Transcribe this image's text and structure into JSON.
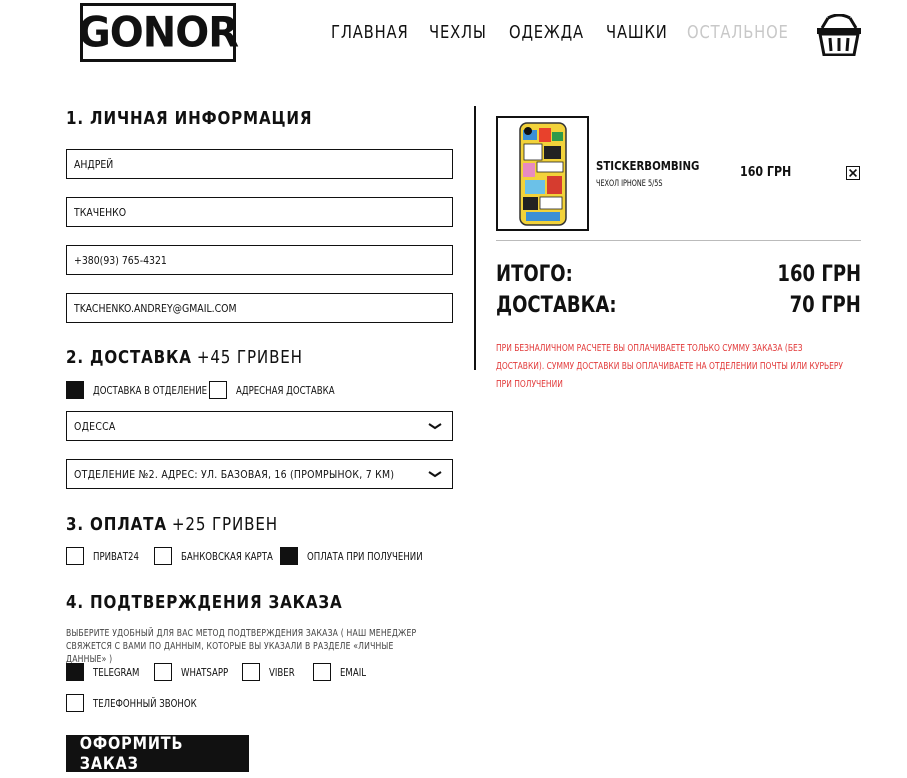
{
  "header": {
    "logo_text": "GONOR",
    "nav": [
      "ГЛАВНАЯ",
      "ЧЕХЛЫ",
      "ОДЕЖДА",
      "ЧАШКИ",
      "ОСТАЛЬНОЕ"
    ],
    "cart_icon": "basket-icon"
  },
  "personal": {
    "title": "1. ЛИЧНАЯ ИНФОРМАЦИЯ",
    "first_name": "АНДРЕЙ",
    "last_name": "ТКАЧЕНКО",
    "phone": "+380(93) 765-4321",
    "email": "TKACHENKO.ANDREY@GMAIL.COM"
  },
  "delivery": {
    "title": "2. ДОСТАВКА",
    "extra": "+45 ГРИВЕН",
    "options": [
      {
        "label": "ДОСТАВКА В ОТДЕЛЕНИЕ",
        "checked": true
      },
      {
        "label": "АДРЕСНАЯ ДОСТАВКА",
        "checked": false
      }
    ],
    "city": "ОДЕССА",
    "branch": "ОТДЕЛЕНИЕ №2. АДРЕС: УЛ. БАЗОВАЯ, 16 (ПРОМРЫНОК, 7 КМ)"
  },
  "payment": {
    "title": "3. ОПЛАТА",
    "extra": "+25 ГРИВЕН",
    "options": [
      {
        "label": "ПРИВАТ24",
        "checked": false
      },
      {
        "label": "БАНКОВСКАЯ КАРТА",
        "checked": false
      },
      {
        "label": "ОПЛАТА ПРИ ПОЛУЧЕНИИ",
        "checked": true
      }
    ]
  },
  "confirm": {
    "title": "4. ПОДТВЕРЖДЕНИЯ ЗАКАЗА",
    "hint": "ВЫБЕРИТЕ УДОБНЫЙ ДЛЯ ВАС МЕТОД ПОДТВЕРЖДЕНИЯ ЗАКАЗА ( НАШ МЕНЕДЖЕР СВЯЖЕТСЯ С ВАМИ ПО ДАННЫМ, КОТОРЫЕ ВЫ УКАЗАЛИ В РАЗДЕЛЕ «ЛИЧНЫЕ ДАННЫЕ» )",
    "options": [
      {
        "label": "TELEGRAM",
        "checked": true
      },
      {
        "label": "WHATSAPP",
        "checked": false
      },
      {
        "label": "VIBER",
        "checked": false
      },
      {
        "label": "EMAIL",
        "checked": false
      },
      {
        "label": "ТЕЛЕФОННЫЙ ЗВОНОК",
        "checked": false
      }
    ]
  },
  "submit_label": "ОФОРМИТЬ ЗАКАЗ",
  "cart": {
    "item_name": "STICKERBOMBING",
    "item_sub": "ЧЕХОЛ IPHONE 5/5S",
    "item_price": "160 ГРН",
    "total_label": "ИТОГО:",
    "total_value": "160 ГРН",
    "delivery_label": "ДОСТАВКА:",
    "delivery_value": "70 ГРН",
    "note": "ПРИ БЕЗНАЛИЧНОМ РАСЧЁТЕ ВЫ ОПЛАЧИВАЕТЕ ТОЛЬКО СУММУ ЗАКАЗА (БЕЗ ДОСТАВКИ). СУММУ ДОСТАВКИ ВЫ ОПЛАЧИВАЕТЕ НА ОТДЕЛЕНИИ ПОЧТЫ ИЛИ КУРЬЕРУ ПРИ ПОЛУЧЕНИИ"
  },
  "colors": {
    "accent": "#111111",
    "muted": "#c8c8c8",
    "note": "#e23a3a"
  }
}
